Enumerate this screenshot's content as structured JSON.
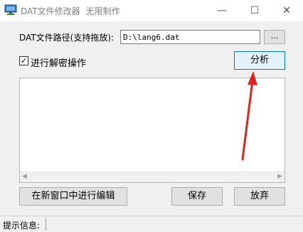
{
  "window": {
    "title": "DAT文件修改器",
    "mode": "无限制作",
    "minimize": "—",
    "maximize": "☐",
    "close": "✕"
  },
  "form": {
    "path_label": "DAT文件路径(支持拖放):",
    "path_value": "D:\\lang6.dat",
    "browse_label": "...",
    "decrypt_label": "进行解密操作",
    "decrypt_checked": true,
    "check_mark": "✓",
    "analyze_label": "分析"
  },
  "output": {
    "content": ""
  },
  "buttons": {
    "edit_label": "在新窗口中进行编辑",
    "save_label": "保存",
    "discard_label": "放弃"
  },
  "status": {
    "label": "提示信息:"
  },
  "colors": {
    "arrow": "#d9261c",
    "focus_border": "#0078d7"
  }
}
